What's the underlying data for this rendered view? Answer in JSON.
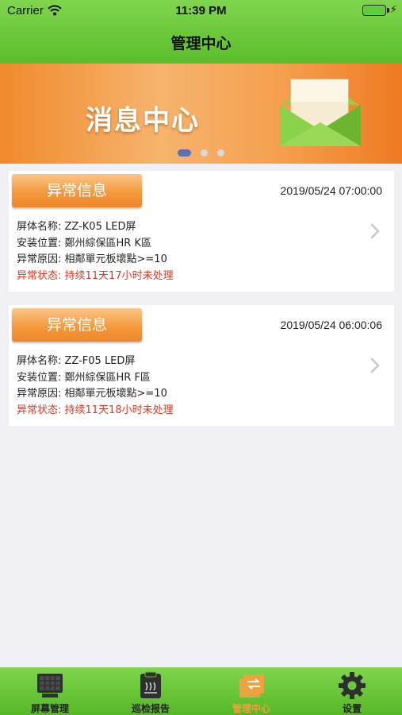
{
  "status_bar": {
    "carrier": "Carrier",
    "time": "11:39 PM"
  },
  "nav": {
    "title": "管理中心"
  },
  "banner": {
    "text": "消息中心",
    "page_count": 3,
    "active_index": 0
  },
  "cards": [
    {
      "tag": "异常信息",
      "date": "2019/05/24 07:00:00",
      "screen_name": "屏体名称:  ZZ-K05 LED屏",
      "location": "安装位置:  鄭州綜保區HR K區",
      "reason": "异常原因:  相鄰單元板壞點>=10",
      "status": "异常状态:  持续11天17小时未处理"
    },
    {
      "tag": "异常信息",
      "date": "2019/05/24 06:00:06",
      "screen_name": "屏体名称:  ZZ-F05 LED屏",
      "location": "安装位置:  鄭州綜保區HR F區",
      "reason": "异常原因:  相鄰單元板壞點>=10",
      "status": "异常状态:  持续11天18小时未处理"
    }
  ],
  "tabbar": {
    "items": [
      {
        "label": "屏幕管理",
        "icon": "screen-grid-icon"
      },
      {
        "label": "巡检报告",
        "icon": "report-icon"
      },
      {
        "label": "管理中心",
        "icon": "management-icon",
        "active": true
      },
      {
        "label": "设置",
        "icon": "gear-icon"
      }
    ]
  },
  "colors": {
    "green": "#5bbd2b",
    "orange": "#f49a3c",
    "alert_red": "#e8331f",
    "dot_active": "#5f6fb3"
  }
}
